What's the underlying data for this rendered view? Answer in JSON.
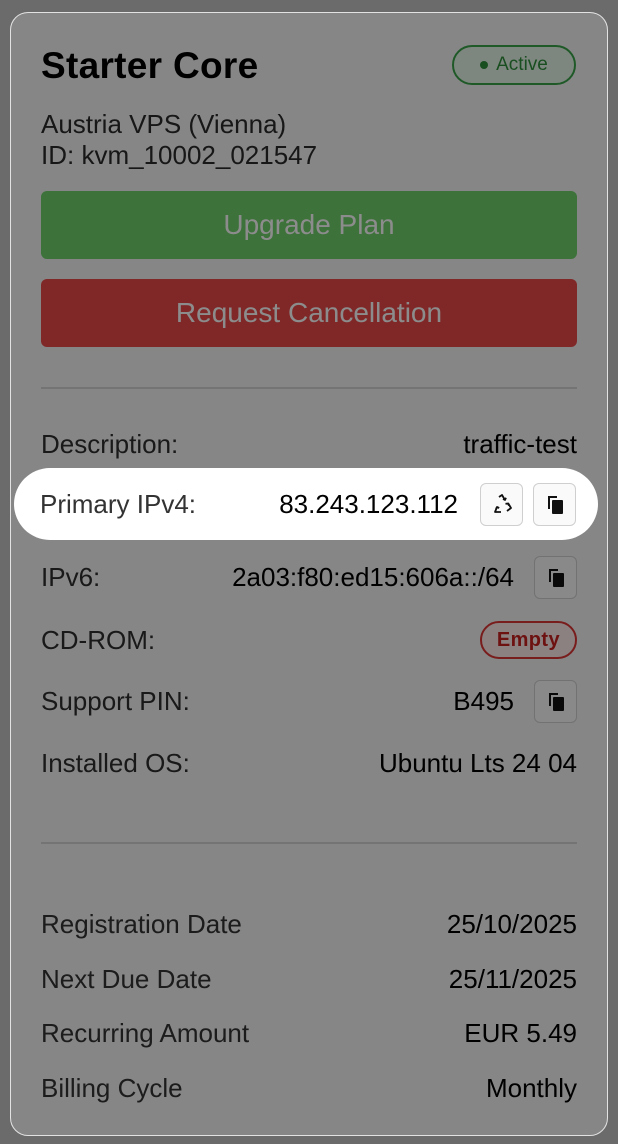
{
  "service": {
    "title": "Starter Core",
    "status": "Active",
    "location": "Austria VPS (Vienna)",
    "id_text": "ID: kvm_10002_021547"
  },
  "actions": {
    "upgrade_label": "Upgrade Plan",
    "cancel_label": "Request Cancellation"
  },
  "details": {
    "description": {
      "label": "Description:",
      "value": "traffic-test"
    },
    "primary_ipv4": {
      "label": "Primary IPv4:",
      "value": "83.243.123.112"
    },
    "ipv6": {
      "label": "IPv6:",
      "value": "2a03:f80:ed15:606a::/64"
    },
    "cdrom": {
      "label": "CD-ROM:",
      "value": "Empty"
    },
    "support_pin": {
      "label": "Support PIN:",
      "value": "B495"
    },
    "installed_os": {
      "label": "Installed OS:",
      "value": "Ubuntu Lts 24 04"
    }
  },
  "billing": {
    "registration_date": {
      "label": "Registration Date",
      "value": "25/10/2025"
    },
    "next_due_date": {
      "label": "Next Due Date",
      "value": "25/11/2025"
    },
    "recurring_amount": {
      "label": "Recurring Amount",
      "value": "EUR 5.49"
    },
    "billing_cycle": {
      "label": "Billing Cycle",
      "value": "Monthly"
    }
  },
  "icons": {
    "recycle": "recycle-icon",
    "copy": "copy-icon"
  },
  "colors": {
    "active_green": "#2f8f3c",
    "upgrade_green": "#6fcf6b",
    "cancel_red": "#ea4a4a",
    "empty_red": "#c82020",
    "overlay": "rgba(0,0,0,0.45)"
  }
}
